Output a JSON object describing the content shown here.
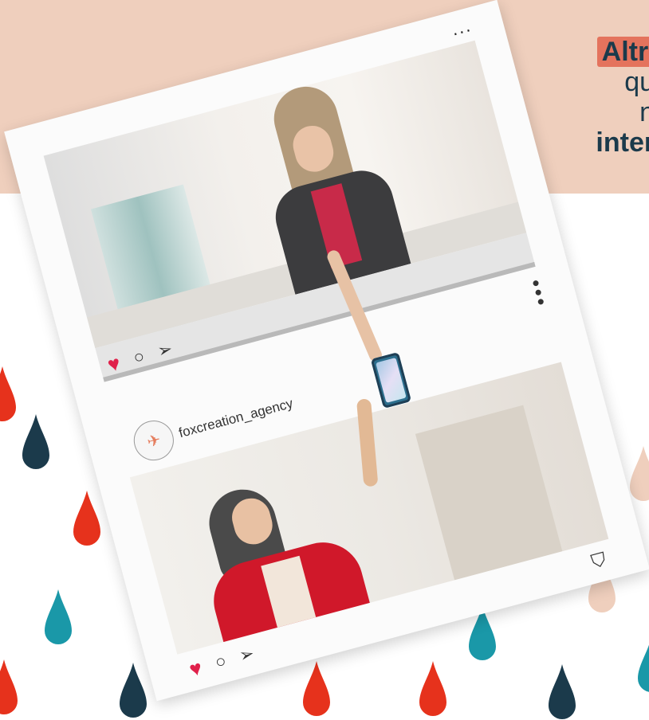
{
  "headline": {
    "line1": "Altro",
    "line2": "que",
    "line3": "ne",
    "line4": "intera"
  },
  "post": {
    "username": "foxcreation_agency",
    "more_icon": "ellipsis-horizontal-icon",
    "more_vertical_icon": "ellipsis-vertical-icon",
    "like_icon": "heart-icon",
    "comment_icon": "comment-icon",
    "share_icon": "send-icon",
    "bookmark_icon": "bookmark-icon"
  },
  "colors": {
    "band": "#efcfbd",
    "accent_red": "#e6321c",
    "navy": "#1b3a4b",
    "teal": "#1a98a8",
    "highlight": "#e4735d",
    "heart": "#e0204a"
  }
}
